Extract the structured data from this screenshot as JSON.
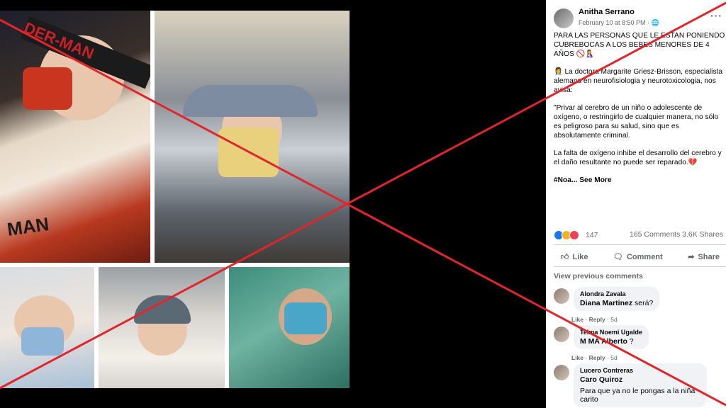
{
  "post": {
    "author": "Anitha Serrano",
    "timestamp": "February 10 at 8:50 PM · ",
    "globe_icon": "globe-icon",
    "more_icon": "···",
    "text_1": "PARA LAS PERSONAS QUE LE ESTAN PONIENDO CUBREBOCAS A LOS BEBES MENORES DE 4 AÑOS 🚫🤱",
    "text_2": "👩‍⚕️ La doctora Margarite Griesz-Brisson, especialista alemana en neurofisiologia y neurotoxicologia, nos avisa:",
    "text_3": "\"Privar al cerebro de un niño o adolescente de oxígeno, o restringirlo de cualquier manera, no sólo es peligroso para su salud, sino que es absolutamente criminal.",
    "text_4": "La falta de oxígeno inhibe el desarrollo del cerebro y el daño resultante no puede ser reparado.💔",
    "hashtag": "#Noa...",
    "see_more": "See More"
  },
  "stats": {
    "reaction_count": "147",
    "comments": "165 Comments",
    "shares": "3.6K Shares"
  },
  "actions": {
    "like": "Like",
    "comment": "Comment",
    "share": "Share"
  },
  "comments": {
    "view_previous": "View previous comments",
    "items": [
      {
        "author": "Alondra Zavala",
        "mention": "Diana Martinez",
        "text": " será?",
        "like": "Like",
        "reply": "Reply",
        "age": "5d"
      },
      {
        "author": "Telma Noemi Ugalde",
        "mention": "M MA Alberto",
        "text": " ?",
        "like": "Like",
        "reply": "Reply",
        "age": "5d"
      },
      {
        "author": "Lucero Contreras",
        "mention": "Caro Quiroz",
        "text_line2": "Para que ya no le pongas a la niña carito"
      }
    ]
  },
  "photos": {
    "headband_text": "DER-MAN",
    "pants_text": "MAN"
  },
  "colors": {
    "cross": "#e0252b",
    "fb_blue": "#1877f2"
  }
}
